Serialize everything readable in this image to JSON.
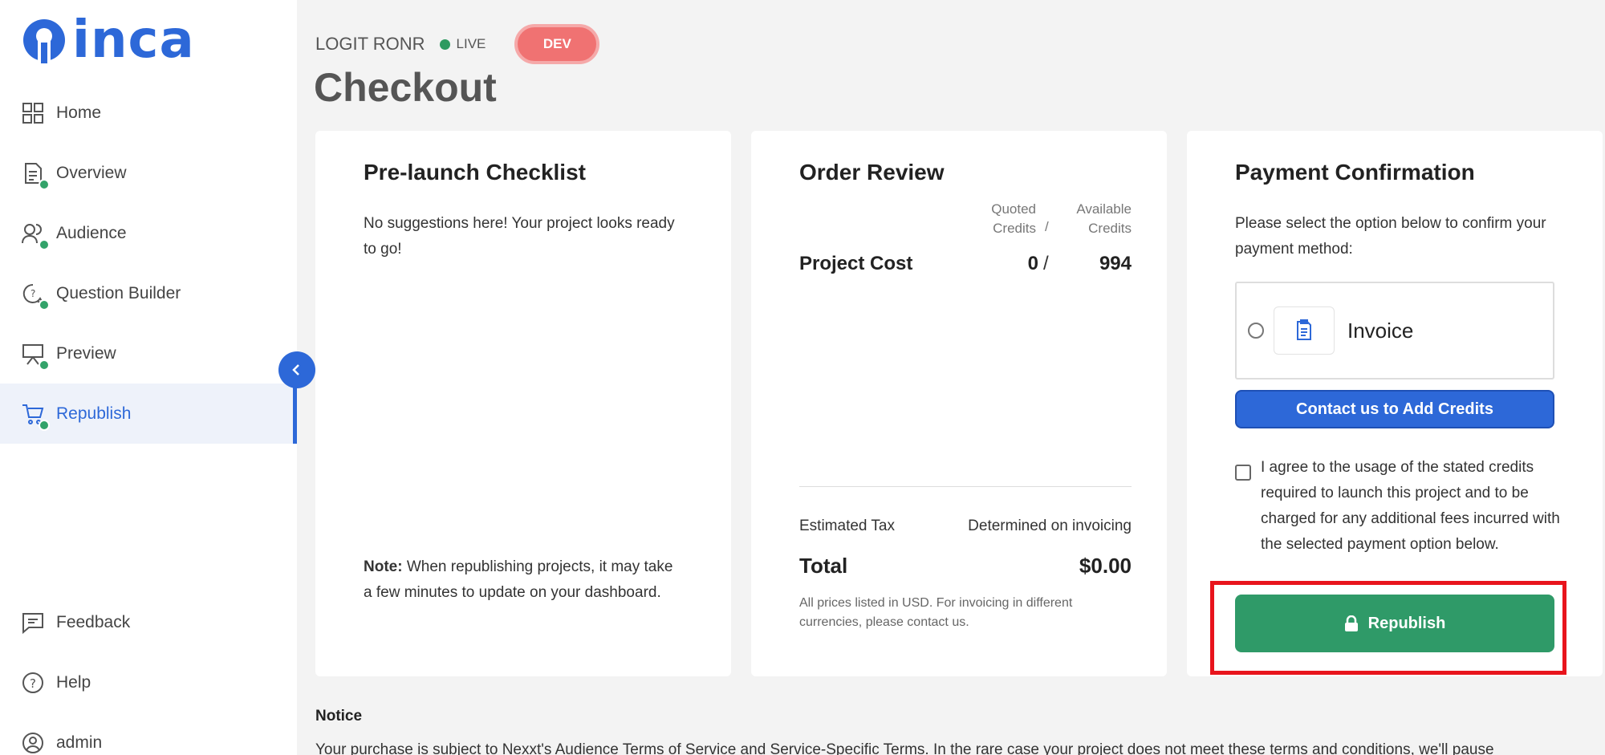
{
  "app": {
    "logo_text": "inca",
    "brand_color": "#2d68d8"
  },
  "sidebar": {
    "items": [
      {
        "label": "Home",
        "icon": "grid-icon",
        "completed": false,
        "active": false
      },
      {
        "label": "Overview",
        "icon": "document-icon",
        "completed": true,
        "active": false
      },
      {
        "label": "Audience",
        "icon": "users-icon",
        "completed": true,
        "active": false
      },
      {
        "label": "Question Builder",
        "icon": "chat-question-icon",
        "completed": true,
        "active": false
      },
      {
        "label": "Preview",
        "icon": "presentation-icon",
        "completed": true,
        "active": false
      },
      {
        "label": "Republish",
        "icon": "cart-icon",
        "completed": true,
        "active": true
      }
    ],
    "bottom_items": [
      {
        "label": "Feedback",
        "icon": "feedback-icon"
      },
      {
        "label": "Help",
        "icon": "help-icon"
      },
      {
        "label": "admin",
        "icon": "user-icon"
      }
    ]
  },
  "header": {
    "project_name": "LOGIT RONR",
    "status": "LIVE",
    "status_color": "#2e9a60",
    "env_badge": "DEV",
    "title": "Checkout"
  },
  "checklist": {
    "title": "Pre-launch Checklist",
    "message": "No suggestions here! Your project looks ready to go!",
    "note_label": "Note:",
    "note_text": " When republishing projects, it may take a few minutes to update on your dashboard."
  },
  "order_review": {
    "title": "Order Review",
    "quoted_header": "Quoted Credits",
    "separator": "/",
    "available_header": "Available Credits",
    "cost_label": "Project Cost",
    "quoted_value": "0",
    "available_value": "994",
    "tax_label": "Estimated Tax",
    "tax_value": "Determined on invoicing",
    "total_label": "Total",
    "total_value": "$0.00",
    "fine_print": "All prices listed in USD. For invoicing in different currencies, please contact us."
  },
  "payment": {
    "title": "Payment Confirmation",
    "instructions": "Please select the option below to confirm your payment method:",
    "invoice_label": "Invoice",
    "contact_button": "Contact us to Add Credits",
    "agree_text": "I agree to the usage of the stated credits required to launch this project and to be charged for any additional fees incurred with the selected payment option below.",
    "republish_button": "Republish"
  },
  "notice": {
    "title": "Notice",
    "text": "Your purchase is subject to Nexxt's Audience Terms of Service and Service-Specific Terms. In the rare case your project does not meet these terms and conditions, we'll pause"
  }
}
